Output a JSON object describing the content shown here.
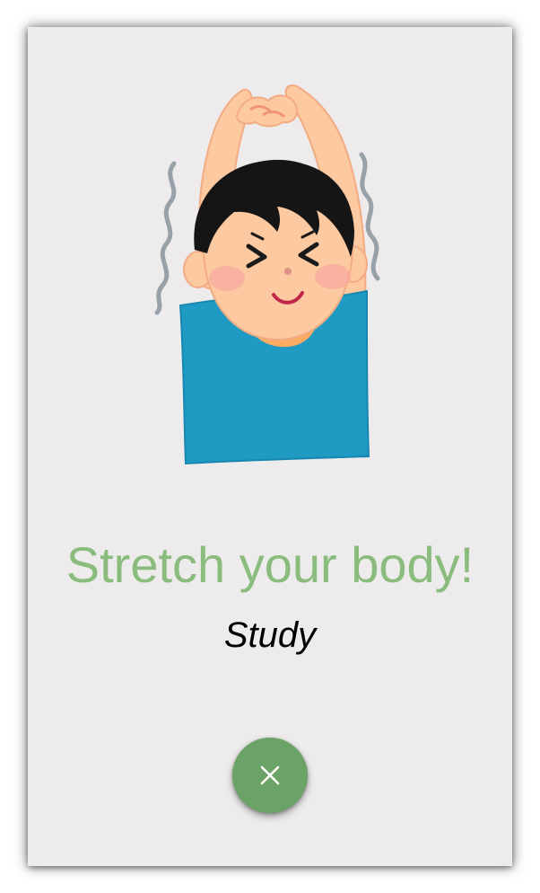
{
  "dialog": {
    "title": "Stretch your body!",
    "subtitle": "Study",
    "close_icon": "close-icon",
    "illustration": "stretching-boy-illustration"
  },
  "colors": {
    "title": "#8abd7d",
    "button": "#6aa365",
    "background": "#eeebec",
    "shirt": "#1e9ac3",
    "skin": "#fdc9a0"
  }
}
